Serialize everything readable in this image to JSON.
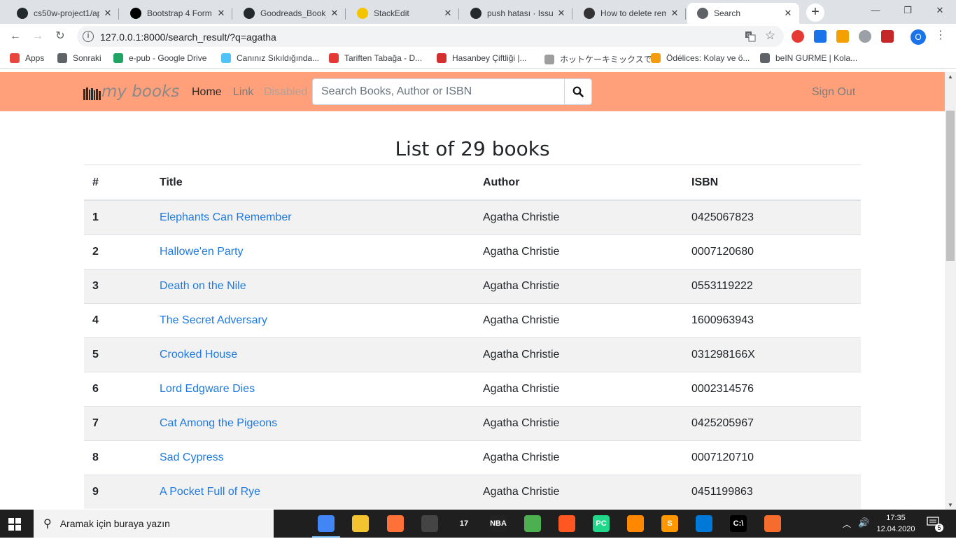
{
  "browser": {
    "tabs": [
      {
        "title": "cs50w-project1/ap",
        "favicon": "github-icon",
        "color": "#24292e"
      },
      {
        "title": "Bootstrap 4 Form",
        "favicon": "medium-icon",
        "color": "#000000"
      },
      {
        "title": "Goodreads_Book_",
        "favicon": "github-icon",
        "color": "#24292e"
      },
      {
        "title": "StackEdit",
        "favicon": "stackedit-icon",
        "color": "#f5c400"
      },
      {
        "title": "push hatası · Issue",
        "favicon": "github-icon",
        "color": "#24292e"
      },
      {
        "title": "How to delete rem",
        "favicon": "terminal-icon",
        "color": "#333333"
      },
      {
        "title": "Search",
        "favicon": "globe-icon",
        "color": "#5f6368"
      }
    ],
    "url": "127.0.0.1:8000/search_result/?q=agatha",
    "bookmarks": [
      {
        "label": "Apps",
        "icon": "apps-grid-icon",
        "color": "#e8453c"
      },
      {
        "label": "Sonraki",
        "icon": "globe-icon",
        "color": "#5f6368"
      },
      {
        "label": "e-pub - Google Drive",
        "icon": "drive-icon",
        "color": "#1fa463"
      },
      {
        "label": "Canınız Sıkıldığında...",
        "icon": "drop-icon",
        "color": "#4fc3f7"
      },
      {
        "label": "Tariften Tabağa - D...",
        "icon": "plate-icon",
        "color": "#e53935"
      },
      {
        "label": "Hasanbey Çiftliği |...",
        "icon": "apple-icon",
        "color": "#d32f2f"
      },
      {
        "label": "ホットケーキミックスで...",
        "icon": "cookpad-icon",
        "color": "#9e9e9e"
      },
      {
        "label": "Ödélices: Kolay ve ö...",
        "icon": "house-icon",
        "color": "#f39c12"
      },
      {
        "label": "beIN GURME | Kola...",
        "icon": "globe-icon",
        "color": "#5f6368"
      }
    ],
    "profile_initial": "O"
  },
  "navbar": {
    "brand": "my books",
    "links": {
      "home": "Home",
      "link": "Link",
      "disabled": "Disabled"
    },
    "search_placeholder": "Search Books, Author or ISBN",
    "signout": "Sign Out",
    "bg_color": "#ffa07a"
  },
  "page": {
    "heading": "List of 29 books",
    "columns": [
      "#",
      "Title",
      "Author",
      "ISBN"
    ],
    "rows": [
      {
        "n": "1",
        "title": "Elephants Can Remember",
        "author": "Agatha Christie",
        "isbn": "0425067823"
      },
      {
        "n": "2",
        "title": "Hallowe'en Party",
        "author": "Agatha Christie",
        "isbn": "0007120680"
      },
      {
        "n": "3",
        "title": "Death on the Nile",
        "author": "Agatha Christie",
        "isbn": "0553119222"
      },
      {
        "n": "4",
        "title": "The Secret Adversary",
        "author": "Agatha Christie",
        "isbn": "1600963943"
      },
      {
        "n": "5",
        "title": "Crooked House",
        "author": "Agatha Christie",
        "isbn": "031298166X"
      },
      {
        "n": "6",
        "title": "Lord Edgware Dies",
        "author": "Agatha Christie",
        "isbn": "0002314576"
      },
      {
        "n": "7",
        "title": "Cat Among the Pigeons",
        "author": "Agatha Christie",
        "isbn": "0425205967"
      },
      {
        "n": "8",
        "title": "Sad Cypress",
        "author": "Agatha Christie",
        "isbn": "0007120710"
      },
      {
        "n": "9",
        "title": "A Pocket Full of Rye",
        "author": "Agatha Christie",
        "isbn": "0451199863"
      }
    ]
  },
  "taskbar": {
    "search_placeholder": "Aramak için buraya yazın",
    "apps": [
      {
        "name": "task-view-icon",
        "label": "",
        "color": "#1f1f1f"
      },
      {
        "name": "chrome-icon",
        "label": "",
        "color": "#4285f4"
      },
      {
        "name": "file-explorer-icon",
        "label": "",
        "color": "#f4c430"
      },
      {
        "name": "firefox-icon",
        "label": "",
        "color": "#ff7139"
      },
      {
        "name": "terminal-app-icon",
        "label": "",
        "color": "#444444"
      },
      {
        "name": "app-17-icon",
        "label": "17",
        "color": "#1f1f1f"
      },
      {
        "name": "nba-2k-icon",
        "label": "NBA",
        "color": "#222222"
      },
      {
        "name": "spreadsheet-icon",
        "label": "",
        "color": "#4caf50"
      },
      {
        "name": "sync-icon",
        "label": "",
        "color": "#ff5722"
      },
      {
        "name": "pycharm-icon",
        "label": "PC",
        "color": "#21d789"
      },
      {
        "name": "vlc-icon",
        "label": "",
        "color": "#ff8800"
      },
      {
        "name": "sublime-icon",
        "label": "S",
        "color": "#ff9800"
      },
      {
        "name": "vscode-icon",
        "label": "",
        "color": "#0078d7"
      },
      {
        "name": "cmd-icon",
        "label": "C:\\",
        "color": "#000000"
      },
      {
        "name": "origin-icon",
        "label": "",
        "color": "#f56c2d"
      }
    ],
    "time": "17:35",
    "date": "12.04.2020",
    "notifications": "5"
  }
}
